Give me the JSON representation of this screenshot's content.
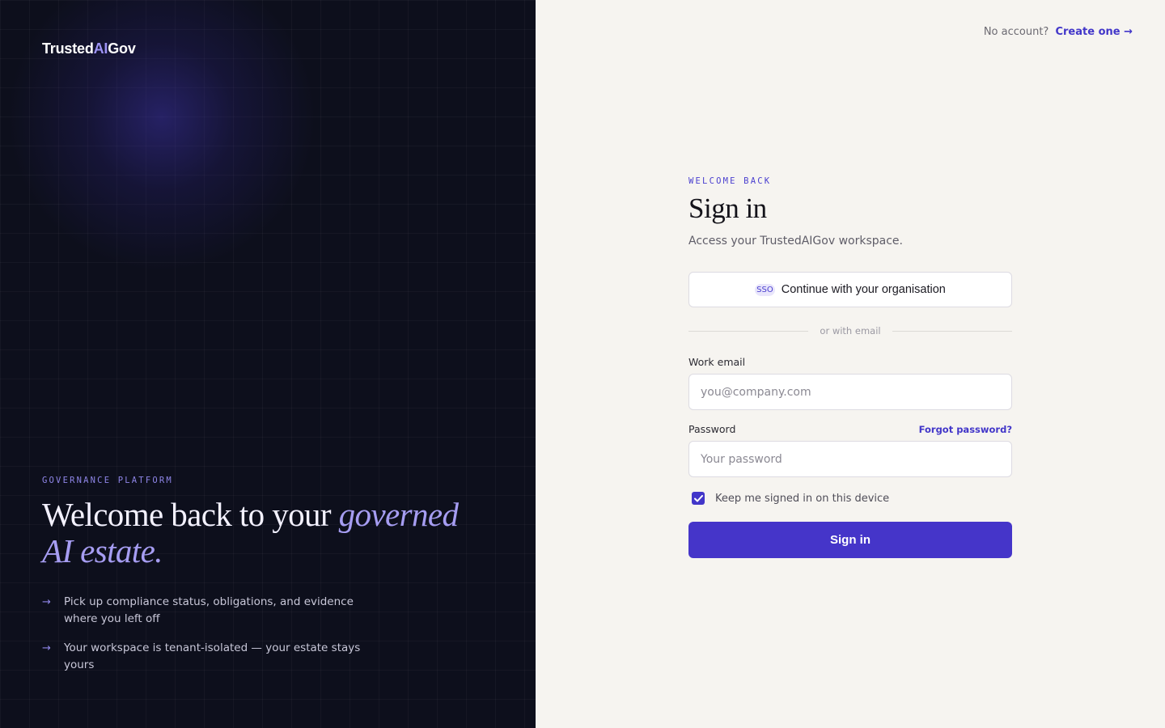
{
  "brand": {
    "logo_prefix": "Trusted",
    "logo_highlight": "AI",
    "logo_suffix": "Gov"
  },
  "hero": {
    "eyebrow": "GOVERNANCE PLATFORM",
    "headline_plain": "Welcome back to your ",
    "headline_italic": "governed AI estate.",
    "bullets": [
      {
        "icon": "arrow-right-icon",
        "text": "Pick up compliance status, obligations, and evidence where you left off"
      },
      {
        "icon": "arrow-right-icon",
        "text": "Your workspace is tenant-isolated — your estate stays yours"
      }
    ]
  },
  "topbar": {
    "prompt": "No account?",
    "link": "Create one →"
  },
  "signin": {
    "eyebrow": "WELCOME BACK",
    "title": "Sign in",
    "subtitle": "Access your TrustedAIGov workspace.",
    "sso_badge": "SSO",
    "sso_label": "Continue with your organisation",
    "divider": "or with email",
    "email_label": "Work email",
    "email_placeholder": "you@company.com",
    "email_value": "",
    "password_label": "Password",
    "forgot_link": "Forgot password?",
    "password_placeholder": "Your password",
    "password_value": "",
    "remember_label": "Keep me signed in on this device",
    "remember_checked": true,
    "submit_label": "Sign in"
  },
  "colors": {
    "accent": "#4535c9",
    "accent_light": "#9d93f5",
    "left_bg": "#0d0f1c",
    "right_bg": "#f6f4f0"
  }
}
